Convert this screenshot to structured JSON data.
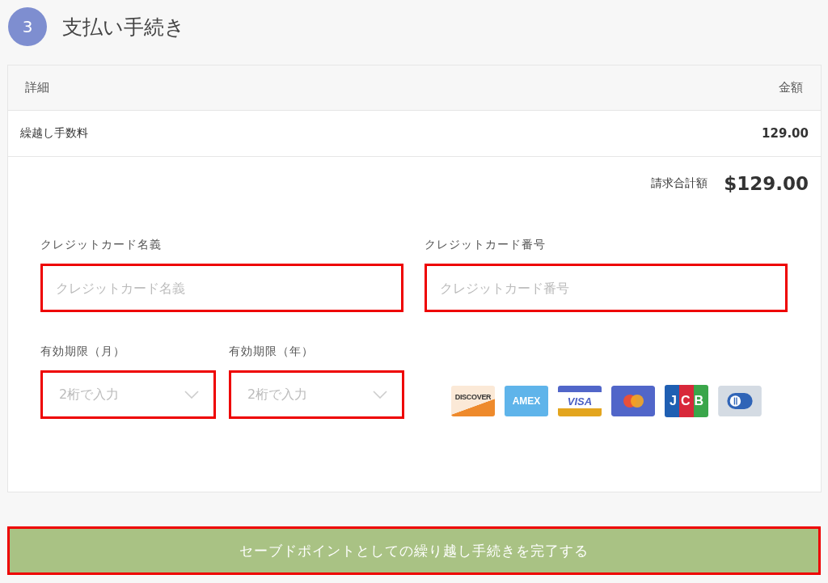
{
  "step": {
    "number": "3",
    "title": "支払い手続き"
  },
  "table": {
    "columns": [
      "詳細",
      "金額"
    ],
    "rows": [
      {
        "item": "繰越し手数料",
        "amount": "129.00"
      }
    ]
  },
  "total": {
    "label": "請求合計額",
    "value": "$129.00"
  },
  "fields": [
    {
      "label": "クレジットカード名義",
      "placeholder": "クレジットカード名義"
    },
    {
      "label": "クレジットカード番号",
      "placeholder": "クレジットカード番号"
    }
  ],
  "expiry": [
    {
      "label": "有効期限（月）",
      "placeholder": "2桁で入力"
    },
    {
      "label": "有効期限（年）",
      "placeholder": "2桁で入力"
    }
  ],
  "cards": [
    {
      "kind": "discover",
      "label": "DISCOVER"
    },
    {
      "kind": "amex",
      "label": "AMEX"
    },
    {
      "kind": "visa",
      "label": "VISA"
    },
    {
      "kind": "mastercard"
    },
    {
      "kind": "jcb",
      "label": "JCB"
    },
    {
      "kind": "diners"
    }
  ],
  "submit": {
    "label": "セーブドポイントとしての繰り越し手続きを完了する"
  }
}
